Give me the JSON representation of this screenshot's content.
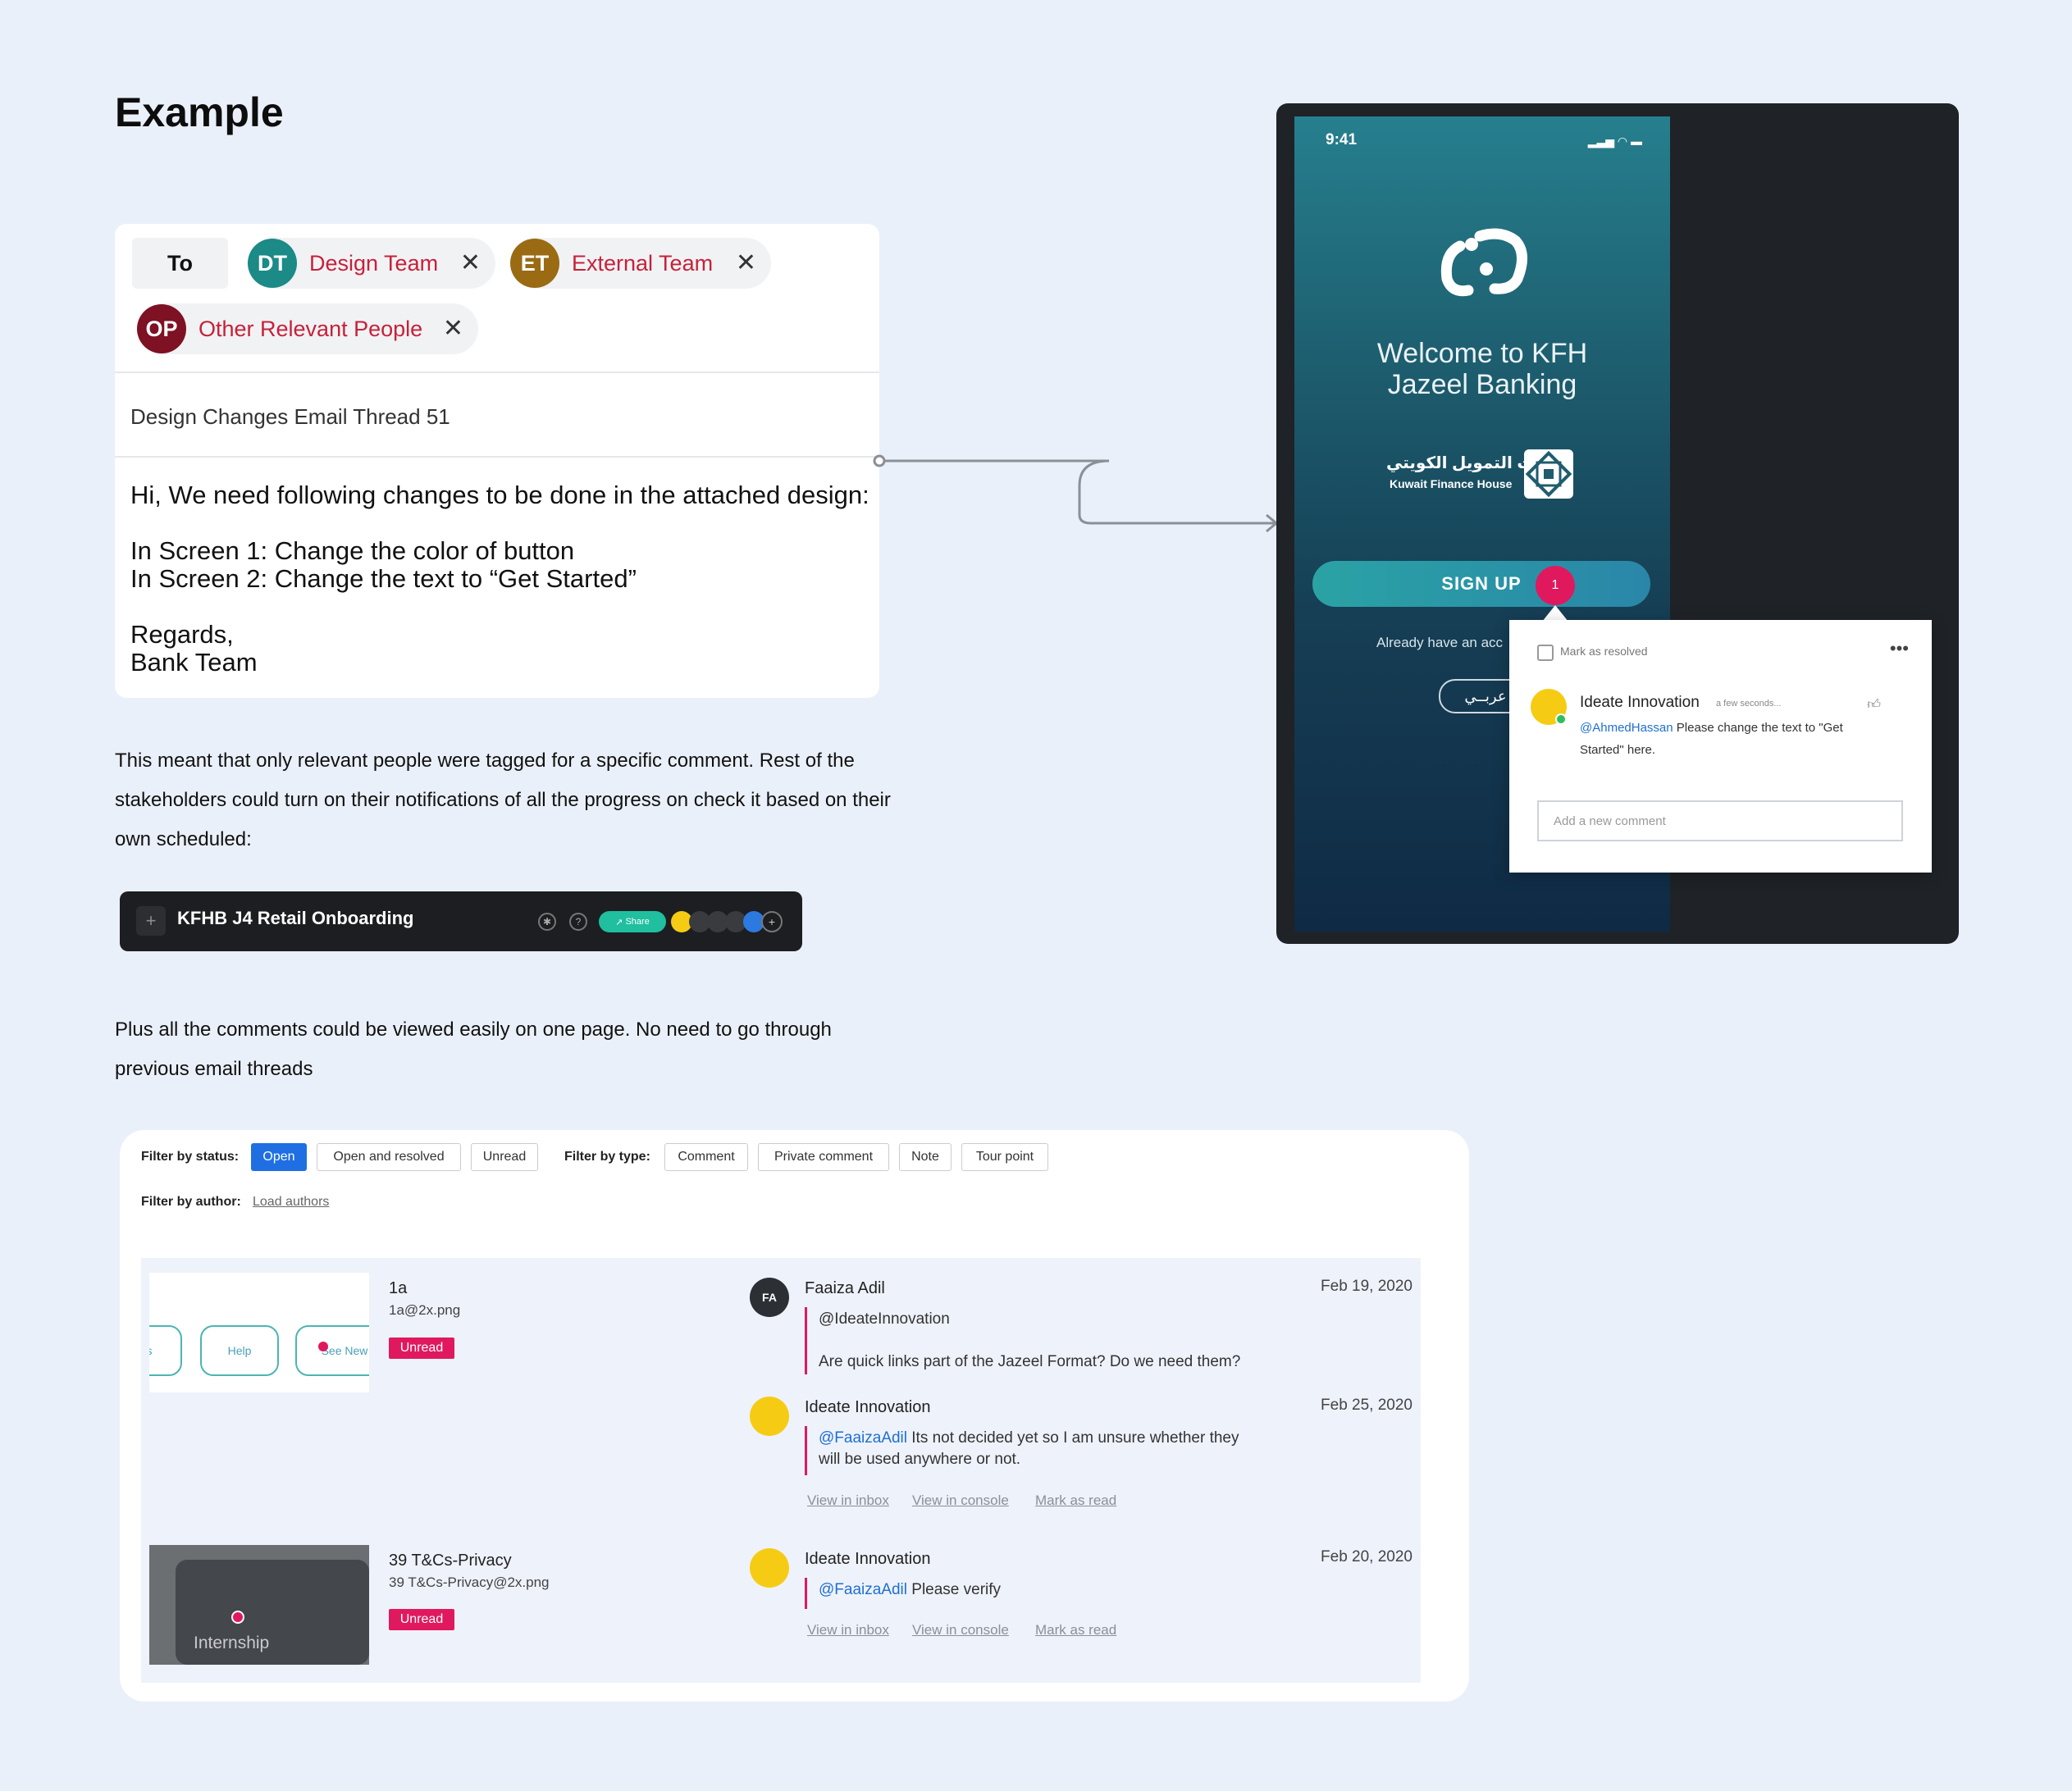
{
  "heading": "Example",
  "email": {
    "to_label": "To",
    "recipients": [
      {
        "initials": "DT",
        "name": "Design Team",
        "color": "#1c8a87"
      },
      {
        "initials": "ET",
        "name": "External Team",
        "color": "#9a6b13"
      },
      {
        "initials": "OP",
        "name": "Other Relevant People",
        "color": "#7e1123"
      }
    ],
    "remove_glyph": "✕",
    "subject": "Design Changes Email Thread 51",
    "body_lines": [
      "Hi, We need following changes to be done in the attached design:",
      "",
      "In Screen 1: Change the color of button",
      "In Screen 2: Change the text to “Get Started”",
      "",
      "Regards,",
      "Bank Team"
    ]
  },
  "paragraph1": "This meant that only relevant people were tagged for a specific comment. Rest of the stakeholders could turn on their notifications of all the progress on check it based on their own scheduled:",
  "paragraph2": "Plus all the comments could be viewed easily on one page. No need to go through previous email threads",
  "toolbar": {
    "add_glyph": "+",
    "title": "KFHB J4 Retail Onboarding",
    "share_label": "Share"
  },
  "phone": {
    "time": "9:41",
    "welcome_line1": "Welcome to KFH",
    "welcome_line2": "Jazeel Banking",
    "kfh_arabic": "بيت التمويل الكويتي",
    "kfh_english": "Kuwait Finance House",
    "signup_label": "SIGN UP",
    "badge_count": "1",
    "already_text": "Already have an acc",
    "arabic_label": "عربــي"
  },
  "popup": {
    "mark_resolved": "Mark as resolved",
    "author": "Ideate Innovation",
    "when": "a few seconds...",
    "mention": "@AhmedHassan",
    "text": " Please change the text to \"Get Started\" here.",
    "placeholder": "Add a new comment"
  },
  "filters": {
    "status_label": "Filter by status:",
    "status_options": [
      "Open",
      "Open and resolved",
      "Unread"
    ],
    "type_label": "Filter by type:",
    "type_options": [
      "Comment",
      "Private comment",
      "Note",
      "Tour point"
    ],
    "author_label": "Filter by author:",
    "load_authors": "Load authors"
  },
  "items": [
    {
      "name": "1a",
      "file": "1a@2x.png",
      "status": "Unread",
      "thumb_pills": [
        "s",
        "Help",
        "See New"
      ],
      "comments": [
        {
          "initials": "FA",
          "author": "Faaiza Adil",
          "date": "Feb 19, 2020",
          "mention": "@IdeateInnovation",
          "text": "Are quick links part of the Jazeel Format? Do we need them?"
        },
        {
          "author": "Ideate Innovation",
          "date": "Feb 25, 2020",
          "mention": "@FaaizaAdil",
          "text": " Its not decided yet so I am unsure whether they",
          "text2": "will be used anywhere or not."
        }
      ],
      "links": [
        "View in inbox",
        "View in console",
        "Mark as read"
      ]
    },
    {
      "name": "39 T&Cs-Privacy",
      "file": "39 T&Cs-Privacy@2x.png",
      "status": "Unread",
      "thumb_label": "Internship",
      "comments": [
        {
          "author": "Ideate Innovation",
          "date": "Feb 20, 2020",
          "mention": "@FaaizaAdil",
          "text": " Please verify"
        }
      ],
      "links": [
        "View in inbox",
        "View in console",
        "Mark as read"
      ]
    }
  ]
}
